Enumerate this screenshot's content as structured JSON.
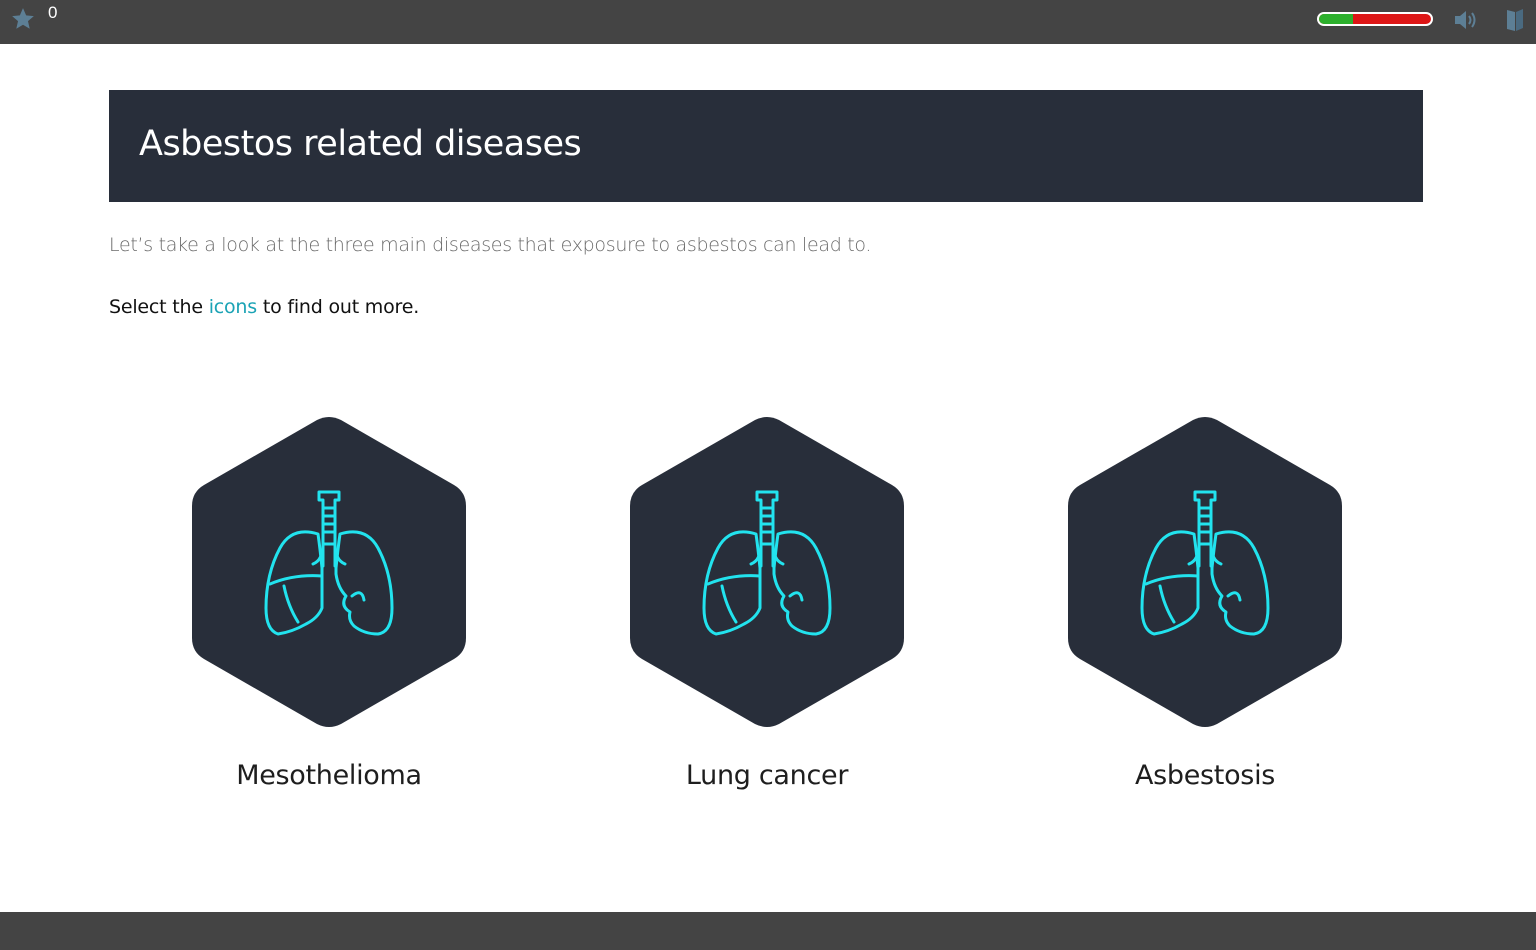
{
  "topbar": {
    "star_icon": "star-icon",
    "score": "0",
    "progress_fraction": 0.3,
    "progress_colors": {
      "done": "#2db02d",
      "remaining": "#dd1616"
    },
    "sound_icon": "speaker-icon",
    "book_icon": "book-icon"
  },
  "banner": {
    "title": "Asbestos related diseases",
    "background": "#282e3a"
  },
  "intro": {
    "text": "Let’s take a look at the three main diseases that exposure to asbestos can lead to."
  },
  "instruction": {
    "before": "Select the ",
    "accent": "icons",
    "after": " to find out more.",
    "accent_color": "#1ba3b5"
  },
  "diseases": [
    {
      "label": "Mesothelioma",
      "icon": "lungs-icon"
    },
    {
      "label": "Lung cancer",
      "icon": "lungs-icon"
    },
    {
      "label": "Asbestosis",
      "icon": "lungs-icon"
    }
  ],
  "colors": {
    "bar": "#444444",
    "hexagon": "#282e3a",
    "lungs_stroke": "#22e3ee"
  }
}
